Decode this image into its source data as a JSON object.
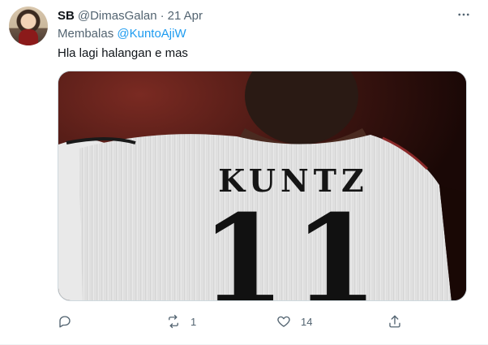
{
  "tweet": {
    "author_name": "SB",
    "author_handle": "@DimasGalan",
    "separator": "·",
    "date": "21 Apr",
    "replying_prefix": "Membalas",
    "replying_to": "@KuntoAjiW",
    "text": "Hla lagi halangan e mas",
    "image": {
      "jersey_name": "KUNTZ",
      "jersey_number": "11"
    },
    "actions": {
      "reply_count": "",
      "retweet_count": "1",
      "like_count": "14"
    }
  },
  "icons": {
    "more": "more-icon",
    "reply": "reply-icon",
    "retweet": "retweet-icon",
    "like": "heart-icon",
    "share": "share-icon"
  },
  "colors": {
    "text_primary": "#0f1419",
    "text_secondary": "#536471",
    "link": "#1d9bf0",
    "border": "#cfd9de"
  }
}
